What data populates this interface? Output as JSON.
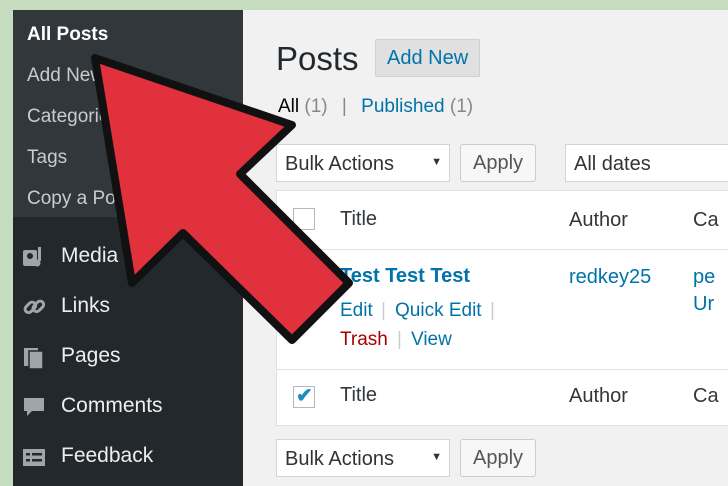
{
  "sidebar": {
    "submenu": [
      {
        "label": "All Posts",
        "current": true
      },
      {
        "label": "Add New"
      },
      {
        "label": "Categories"
      },
      {
        "label": "Tags"
      },
      {
        "label": "Copy a Post"
      }
    ],
    "menu": [
      {
        "label": "Media",
        "icon": "media-icon"
      },
      {
        "label": "Links",
        "icon": "links-icon"
      },
      {
        "label": "Pages",
        "icon": "pages-icon"
      },
      {
        "label": "Comments",
        "icon": "comments-icon"
      },
      {
        "label": "Feedback",
        "icon": "feedback-icon"
      }
    ]
  },
  "header": {
    "title": "Posts",
    "add_new": "Add New"
  },
  "filters": {
    "all_label": "All",
    "all_count": "(1)",
    "separator": "|",
    "published_label": "Published",
    "published_count": "(1)"
  },
  "top_nav": {
    "bulk_actions": "Bulk Actions",
    "apply": "Apply",
    "dates": "All dates"
  },
  "bottom_nav": {
    "bulk_actions": "Bulk Actions",
    "apply": "Apply"
  },
  "table": {
    "columns": {
      "title": "Title",
      "author": "Author",
      "categories_partial": "Ca"
    },
    "footer_columns": {
      "title": "Title",
      "author": "Author",
      "categories_partial": "Ca"
    },
    "rows": [
      {
        "title": "Test Test Test",
        "author": "redkey25",
        "categories_partial_1": "pe",
        "categories_partial_2": "Ur",
        "actions": {
          "edit": "Edit",
          "quick_edit": "Quick Edit",
          "trash": "Trash",
          "view": "View",
          "sep": "|"
        }
      }
    ]
  },
  "colors": {
    "sidebar_bg": "#23282d",
    "submenu_bg": "#32373c",
    "link": "#0073aa",
    "trash": "#aa0000",
    "arrow_fill": "#e0313d",
    "border_bg": "#c5dcbf"
  }
}
